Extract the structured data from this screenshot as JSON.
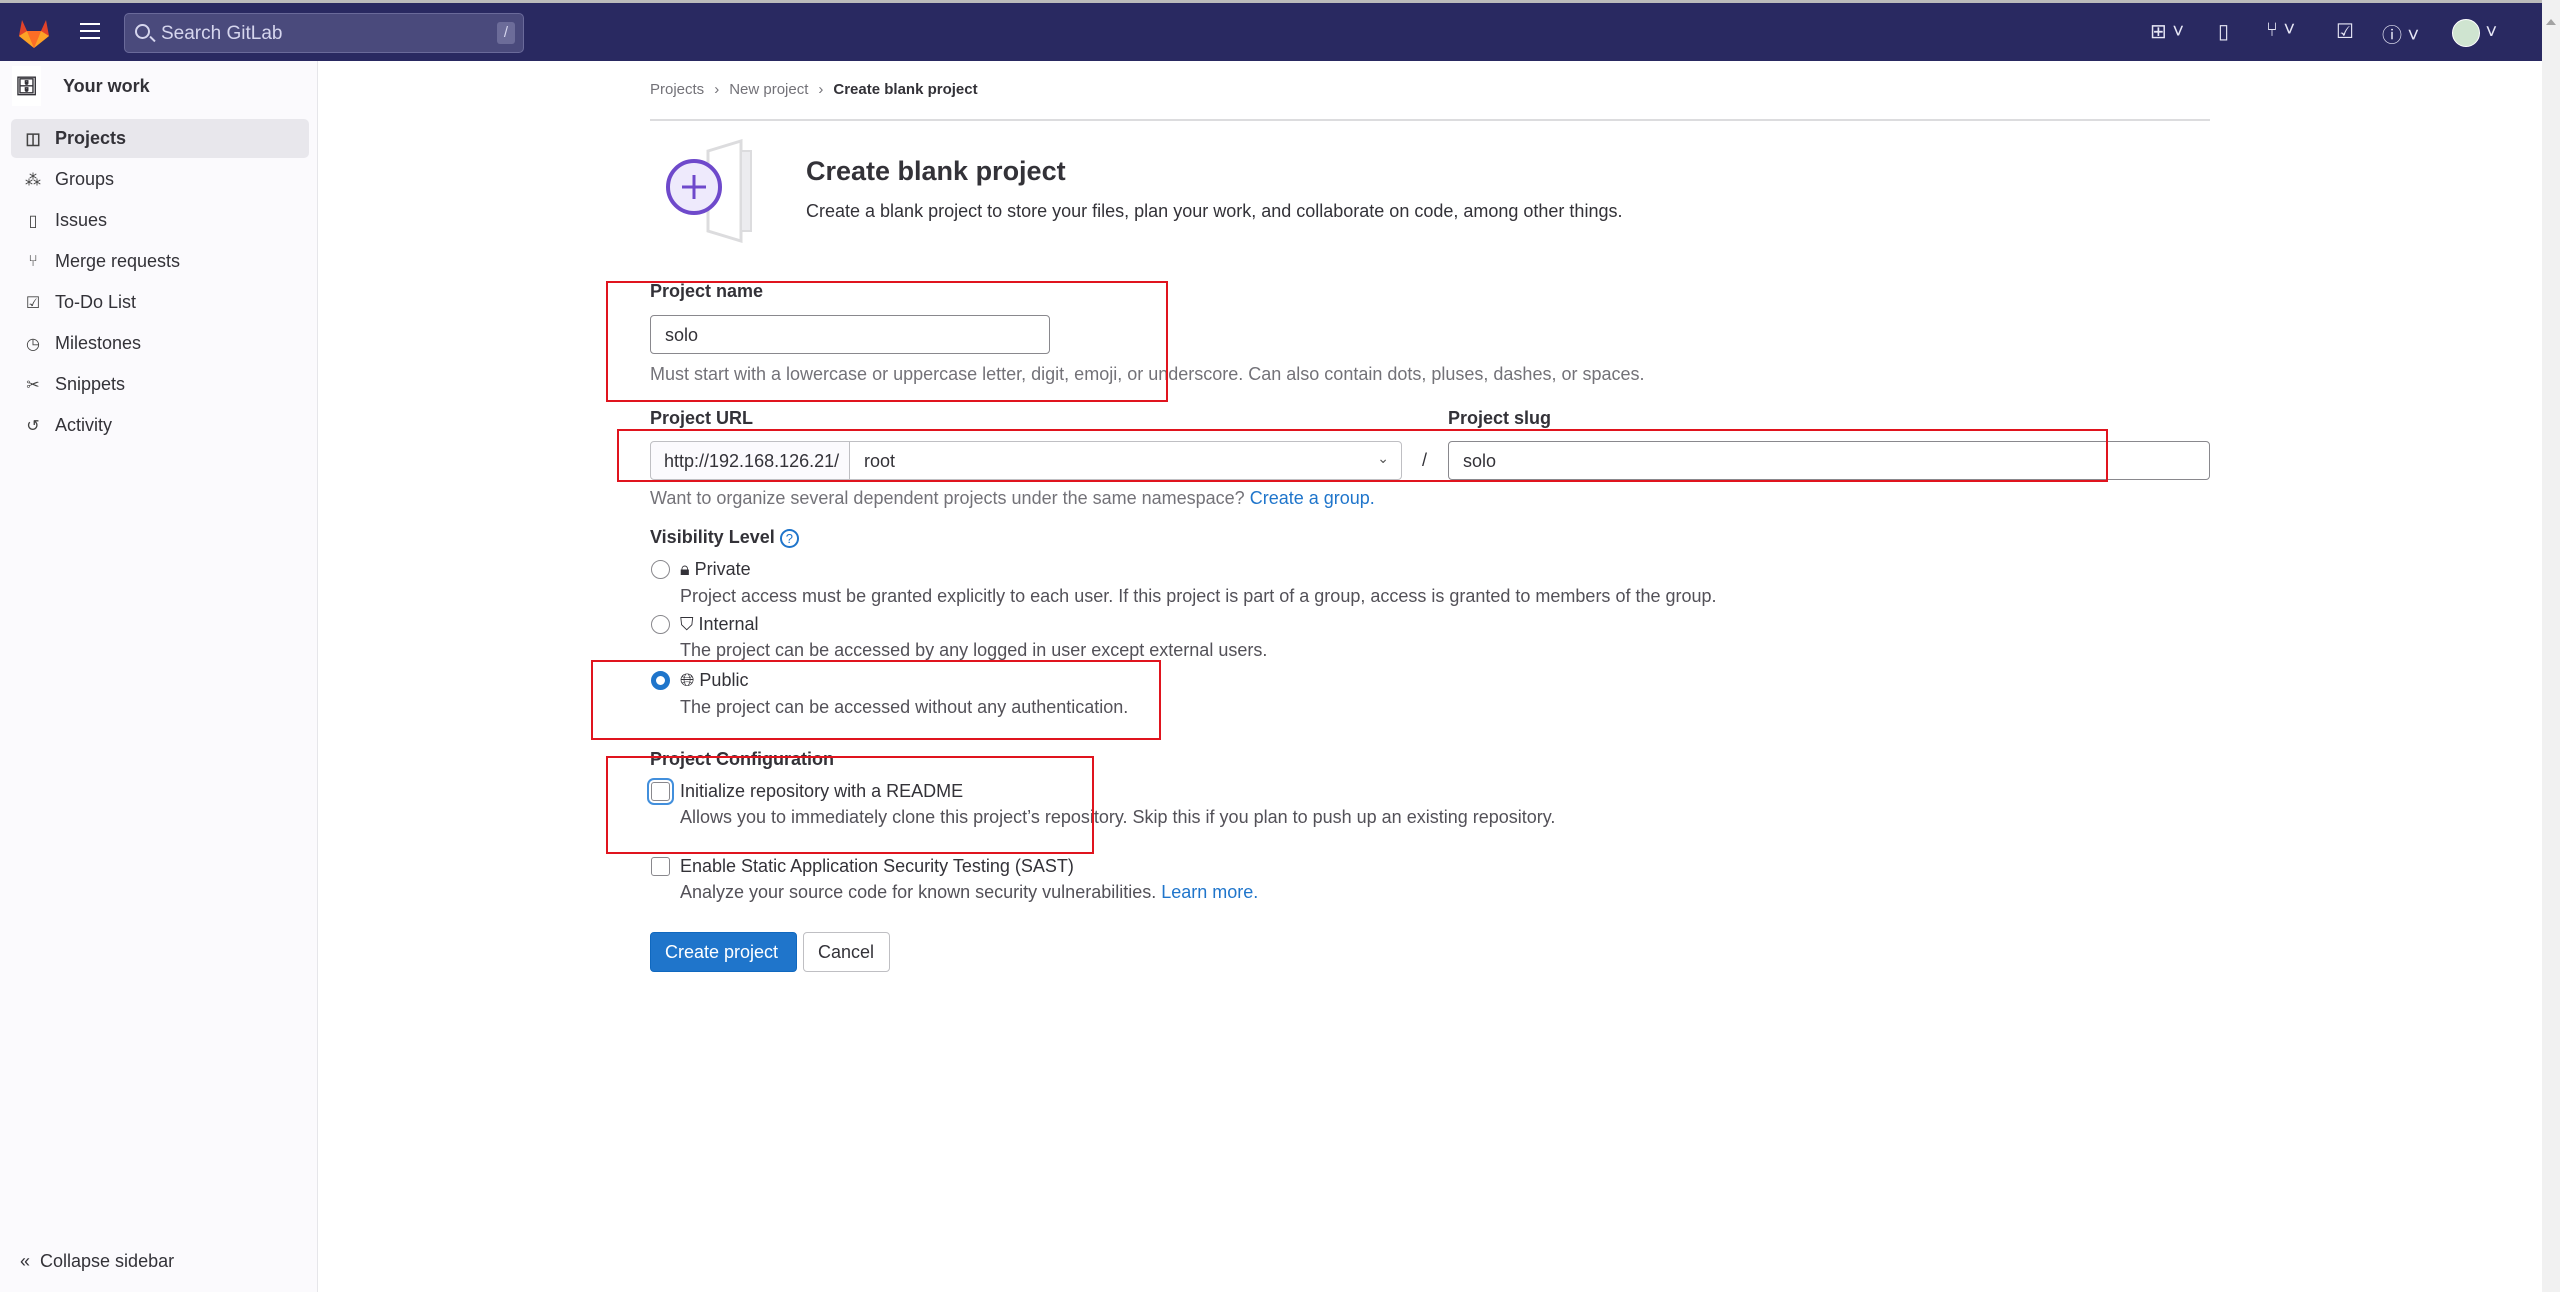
{
  "topbar": {
    "search_placeholder": "Search GitLab",
    "search_shortcut": "/",
    "icons": [
      "plus-square-icon",
      "issues-icon",
      "merge-request-icon",
      "todo-icon",
      "help-icon",
      "avatar"
    ]
  },
  "sidebar": {
    "context": "Your work",
    "items": [
      {
        "label": "Projects",
        "icon": "project-icon",
        "active": true
      },
      {
        "label": "Groups",
        "icon": "group-icon"
      },
      {
        "label": "Issues",
        "icon": "issues-icon"
      },
      {
        "label": "Merge requests",
        "icon": "merge-request-icon"
      },
      {
        "label": "To-Do List",
        "icon": "todo-icon"
      },
      {
        "label": "Milestones",
        "icon": "clock-icon"
      },
      {
        "label": "Snippets",
        "icon": "snippet-icon"
      },
      {
        "label": "Activity",
        "icon": "history-icon"
      }
    ],
    "collapse": "Collapse sidebar"
  },
  "breadcrumb": [
    "Projects",
    "New project",
    "Create blank project"
  ],
  "header": {
    "title": "Create blank project",
    "description": "Create a blank project to store your files, plan your work, and collaborate on code, among other things."
  },
  "form": {
    "name_label": "Project name",
    "name_value": "solo",
    "name_help": "Must start with a lowercase or uppercase letter, digit, emoji, or underscore. Can also contain dots, pluses, dashes, or spaces.",
    "url_label": "Project URL",
    "url_prefix": "http://192.168.126.21/",
    "namespace": "root",
    "separator": "/",
    "slug_label": "Project slug",
    "slug_value": "solo",
    "namespace_help": "Want to organize several dependent projects under the same namespace?",
    "namespace_link": "Create a group.",
    "visibility_label": "Visibility Level",
    "visibility": [
      {
        "label": "Private",
        "desc": "Project access must be granted explicitly to each user. If this project is part of a group, access is granted to members of the group.",
        "selected": false
      },
      {
        "label": "Internal",
        "desc": "The project can be accessed by any logged in user except external users.",
        "selected": false
      },
      {
        "label": "Public",
        "desc": "The project can be accessed without any authentication.",
        "selected": true
      }
    ],
    "config_label": "Project Configuration",
    "readme_label": "Initialize repository with a README",
    "readme_desc": "Allows you to immediately clone this project’s repository. Skip this if you plan to push up an existing repository.",
    "readme_checked": false,
    "sast_label": "Enable Static Application Security Testing (SAST)",
    "sast_desc": "Analyze your source code for known security vulnerabilities.",
    "sast_link": "Learn more.",
    "sast_checked": false,
    "create": "Create project",
    "cancel": "Cancel"
  },
  "colors": {
    "topbar": "#292961",
    "primary": "#1f75cb",
    "annotation": "#e0141e"
  }
}
